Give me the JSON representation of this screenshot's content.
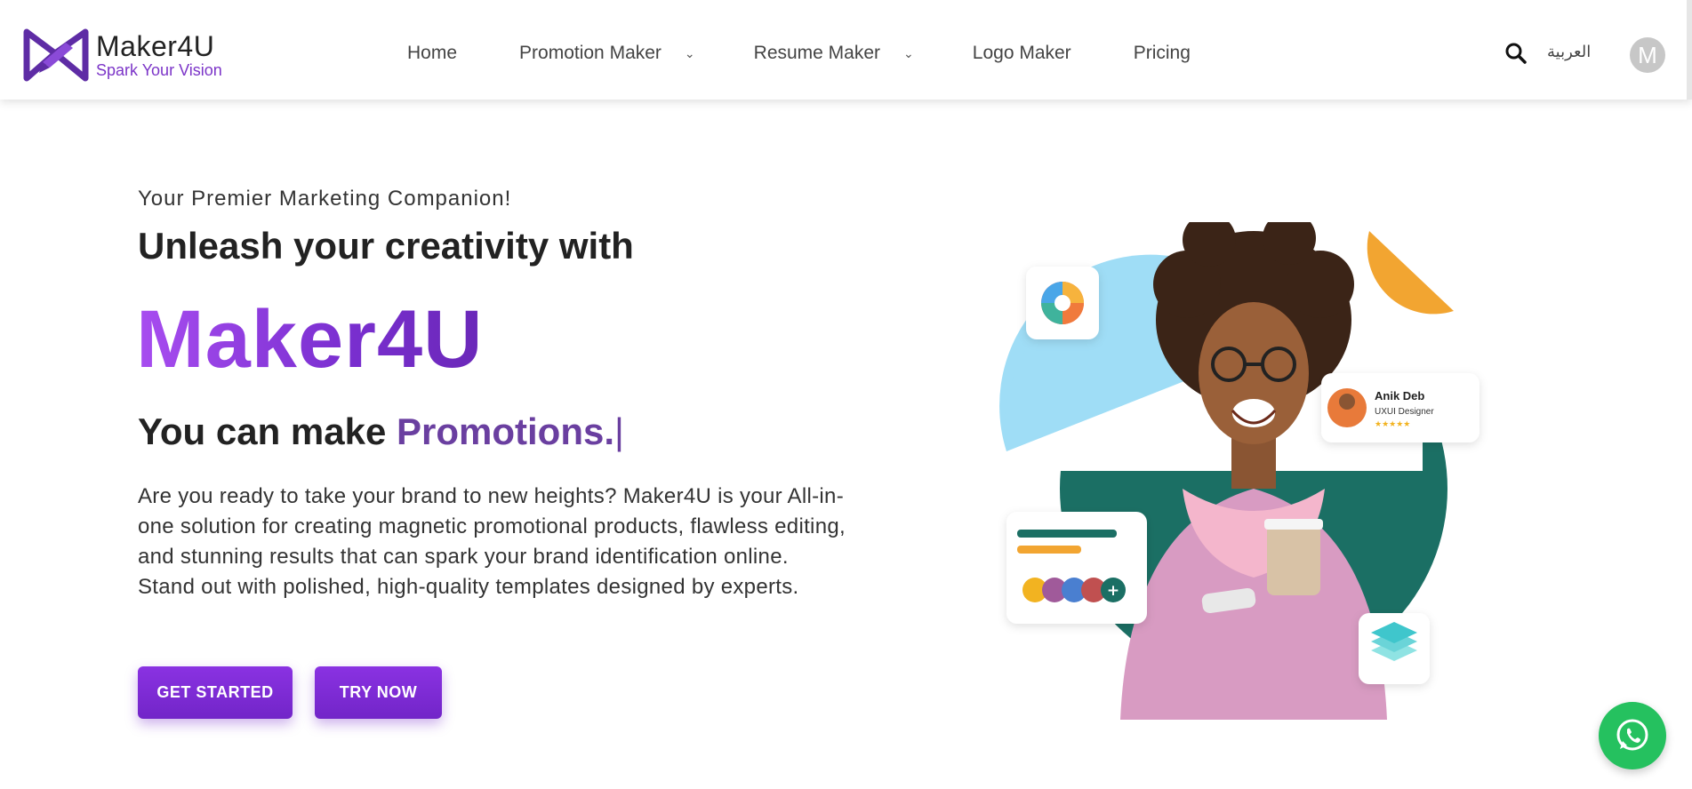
{
  "header": {
    "logo": {
      "title": "Maker4U",
      "tagline": "Spark Your Vision"
    },
    "nav": [
      {
        "label": "Home"
      },
      {
        "label": "Promotion Maker"
      },
      {
        "label": "Resume Maker"
      },
      {
        "label": "Logo Maker"
      },
      {
        "label": "Pricing"
      }
    ],
    "language": "العربية",
    "avatar_initial": "M"
  },
  "hero": {
    "eyebrow": "Your Premier Marketing Companion!",
    "headline": "Unleash your creativity with",
    "brand": "Maker4U",
    "make_prefix": "You can make",
    "make_word": "Promotions.",
    "cursor": "|",
    "description": "Are you ready to take your brand to new heights? Maker4U is your All-in-one solution for creating magnetic promotional products, flawless editing, and stunning results that can spark your brand identification online. Stand out with polished, high-quality templates designed by experts.",
    "buttons": {
      "get_started": "GET STARTED",
      "try_now": "TRY NOW"
    }
  },
  "illustration": {
    "profile_card": {
      "name": "Anik Deb",
      "role": "UXUI Designer",
      "rating": "★★★★★"
    },
    "team_plus": "+"
  },
  "colors": {
    "brand_purple": "#7a2fd0",
    "accent_purple": "#6a3fa0",
    "teal": "#1b6f64",
    "light_blue": "#9fddf6",
    "orange": "#f2a531",
    "whatsapp_green": "#25c15f"
  },
  "icons": [
    "search-icon",
    "chevron-down-icon",
    "whatsapp-icon",
    "color-wheel-icon",
    "layers-icon"
  ]
}
